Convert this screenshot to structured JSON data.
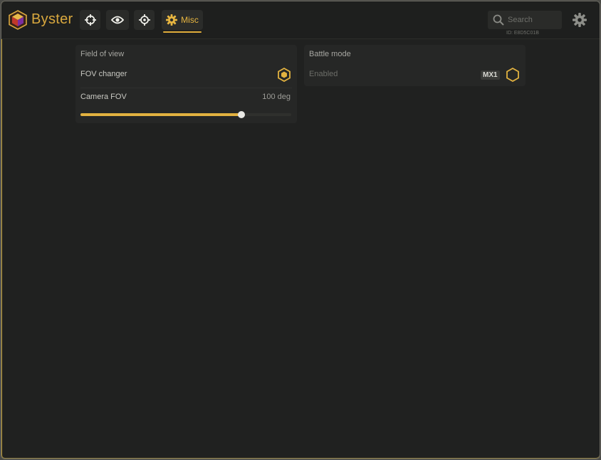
{
  "app": {
    "brand": "Byster",
    "tabs": [
      {
        "icon": "crosshair-icon",
        "label": ""
      },
      {
        "icon": "eye-icon",
        "label": ""
      },
      {
        "icon": "target-icon",
        "label": ""
      },
      {
        "icon": "gear-icon",
        "label": "Misc",
        "active": true
      }
    ],
    "search_placeholder": "Search",
    "id_label": "ID: E8D5C01B"
  },
  "panels": {
    "field_of_view": {
      "title": "Field of view",
      "fov_changer_label": "FOV changer",
      "fov_changer_enabled": true,
      "camera_fov_label": "Camera FOV",
      "camera_fov_value": "100 deg",
      "camera_fov_fraction": 0.765
    },
    "battle_mode": {
      "title": "Battle mode",
      "enabled_label": "Enabled",
      "keybind": "MX1",
      "enabled": false
    }
  },
  "colors": {
    "accent": "#e2b240",
    "background": "#202120",
    "panel": "#262726"
  }
}
